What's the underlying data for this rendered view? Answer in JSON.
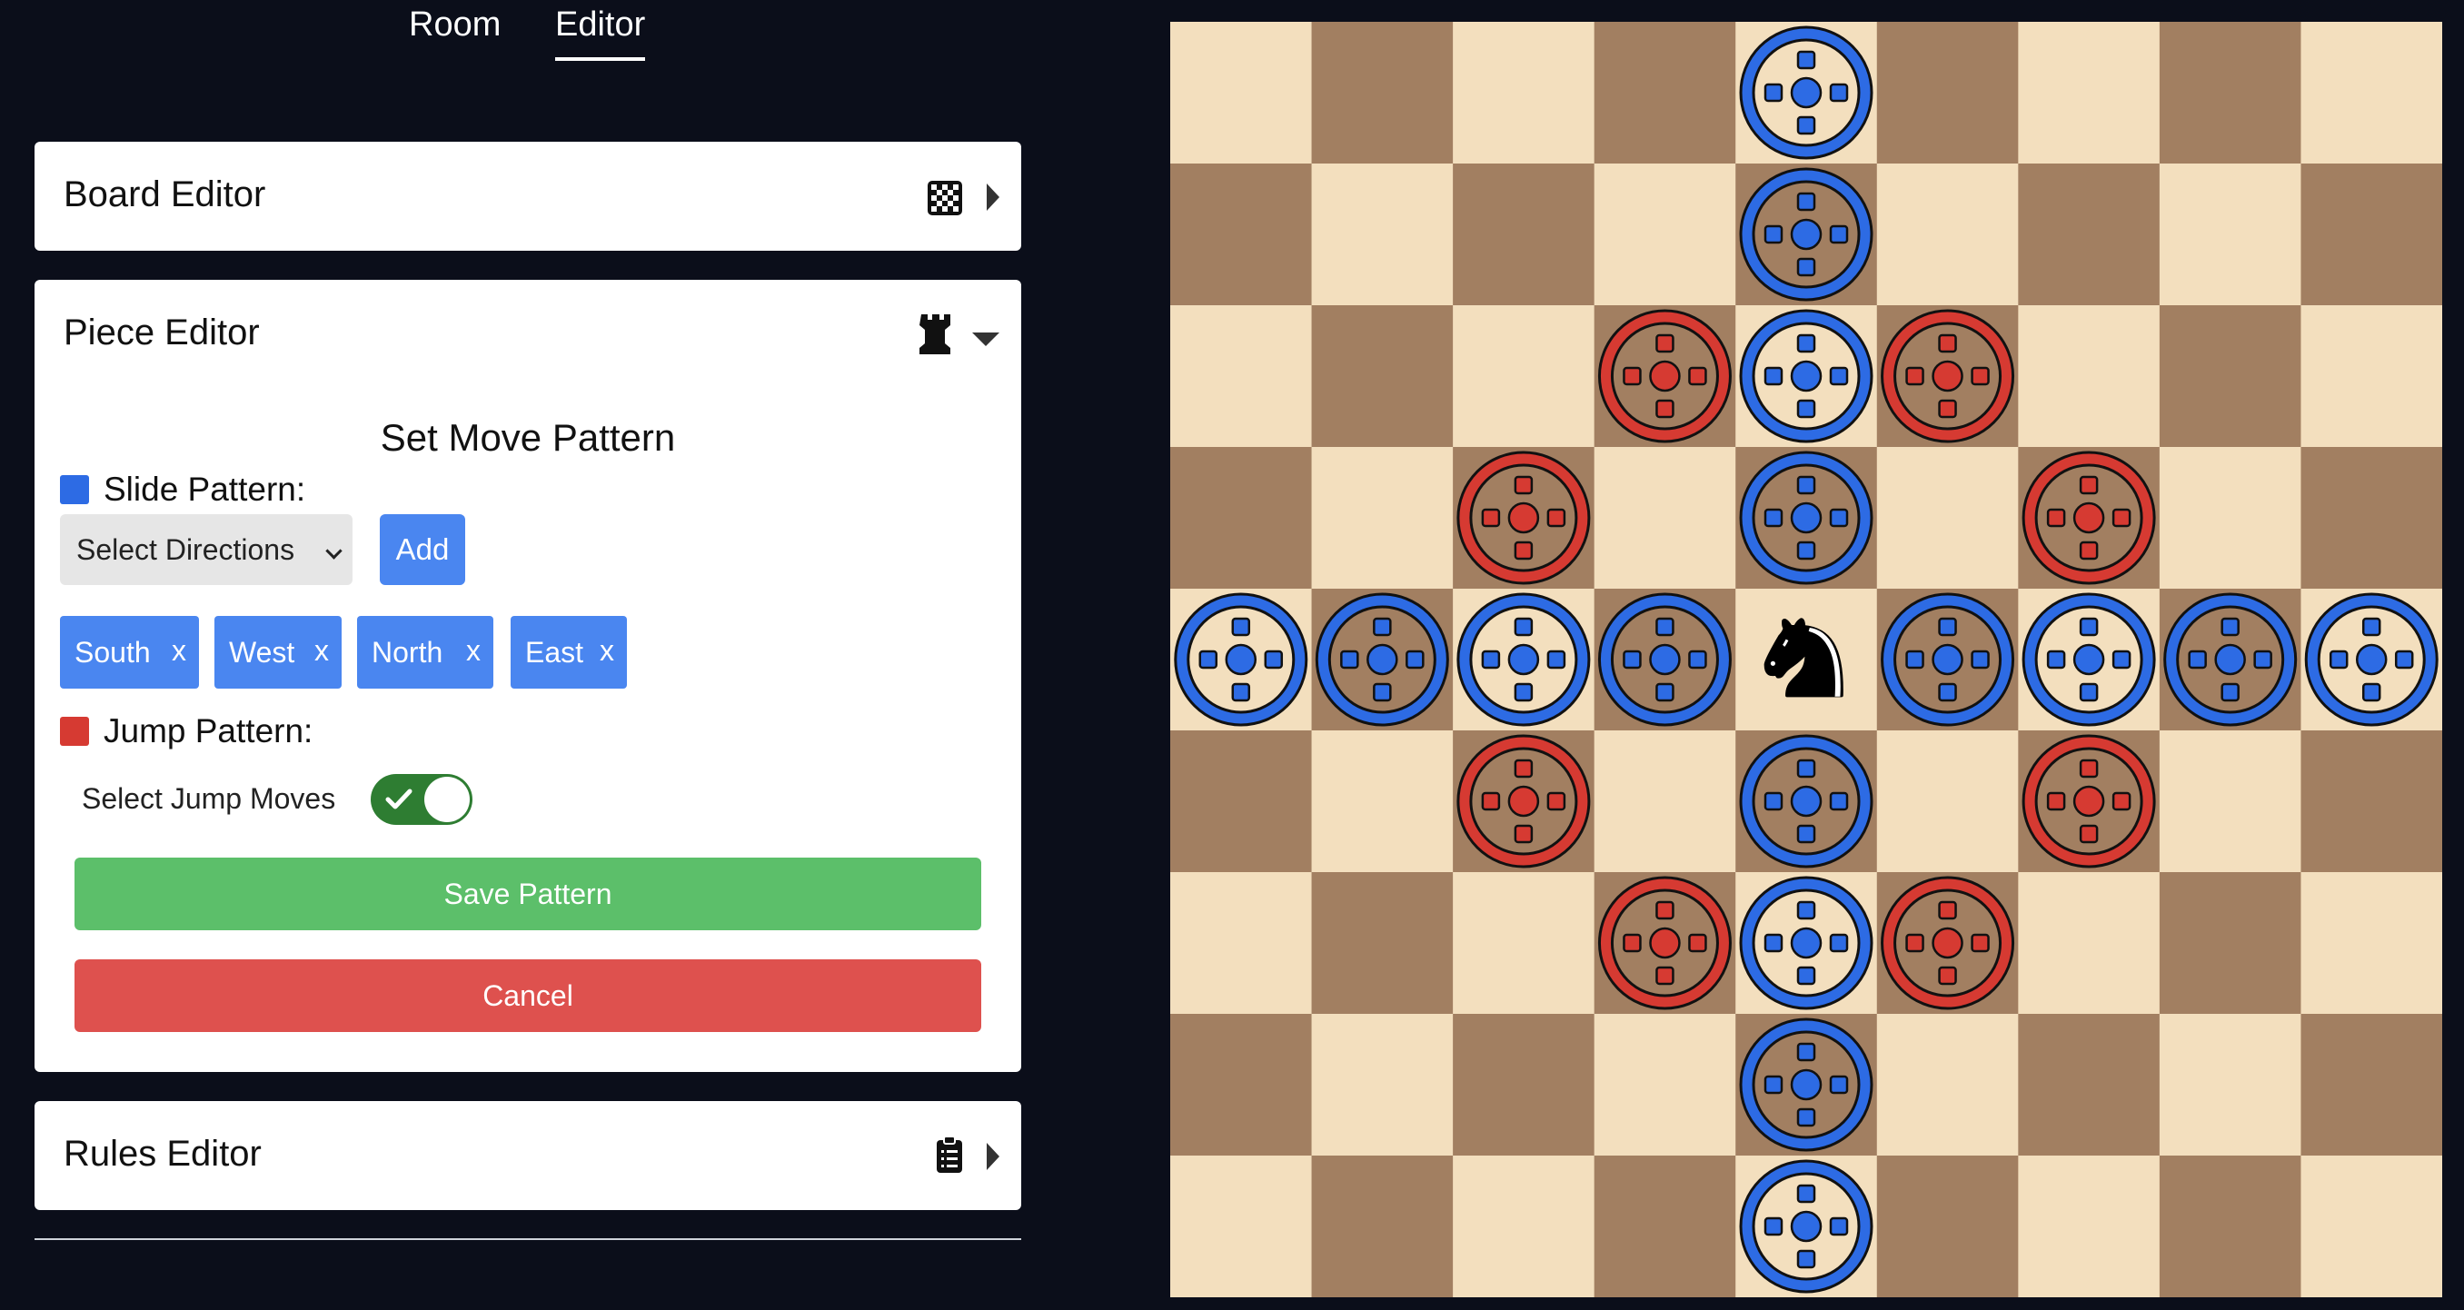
{
  "nav": {
    "tabs": [
      "Room",
      "Editor"
    ],
    "active": "Editor"
  },
  "board_editor": {
    "title": "Board Editor"
  },
  "piece_editor": {
    "title": "Piece Editor",
    "section_title": "Set Move Pattern",
    "slide": {
      "label": "Slide Pattern:",
      "color": "#2d6be4",
      "select_value": "Select Directions",
      "add_label": "Add",
      "directions": [
        "South",
        "West",
        "North",
        "East"
      ],
      "remove_label": "x"
    },
    "jump": {
      "label": "Jump Pattern:",
      "color": "#d63a32",
      "toggle_label": "Select Jump Moves",
      "toggle_on": true
    },
    "save_label": "Save Pattern",
    "cancel_label": "Cancel",
    "colors": {
      "save": "#5cbf6a",
      "cancel": "#de514e"
    }
  },
  "rules_editor": {
    "title": "Rules Editor"
  },
  "board": {
    "size": 9,
    "light_square": "#f3dfbe",
    "dark_square": "#a27f61",
    "center_piece": {
      "name": "knight",
      "color": "#000000"
    },
    "piece_square": [
      4,
      4
    ],
    "slide_markers": [
      [
        0,
        4
      ],
      [
        1,
        4
      ],
      [
        2,
        4
      ],
      [
        3,
        4
      ],
      [
        5,
        4
      ],
      [
        6,
        4
      ],
      [
        7,
        4
      ],
      [
        8,
        4
      ],
      [
        4,
        0
      ],
      [
        4,
        1
      ],
      [
        4,
        2
      ],
      [
        4,
        3
      ],
      [
        4,
        5
      ],
      [
        4,
        6
      ],
      [
        4,
        7
      ],
      [
        4,
        8
      ]
    ],
    "jump_markers": [
      [
        2,
        3
      ],
      [
        2,
        5
      ],
      [
        3,
        2
      ],
      [
        3,
        6
      ],
      [
        5,
        2
      ],
      [
        5,
        6
      ],
      [
        6,
        3
      ],
      [
        6,
        5
      ]
    ],
    "marker_colors": {
      "slide": "#2d6be4",
      "jump": "#d63a32"
    }
  }
}
